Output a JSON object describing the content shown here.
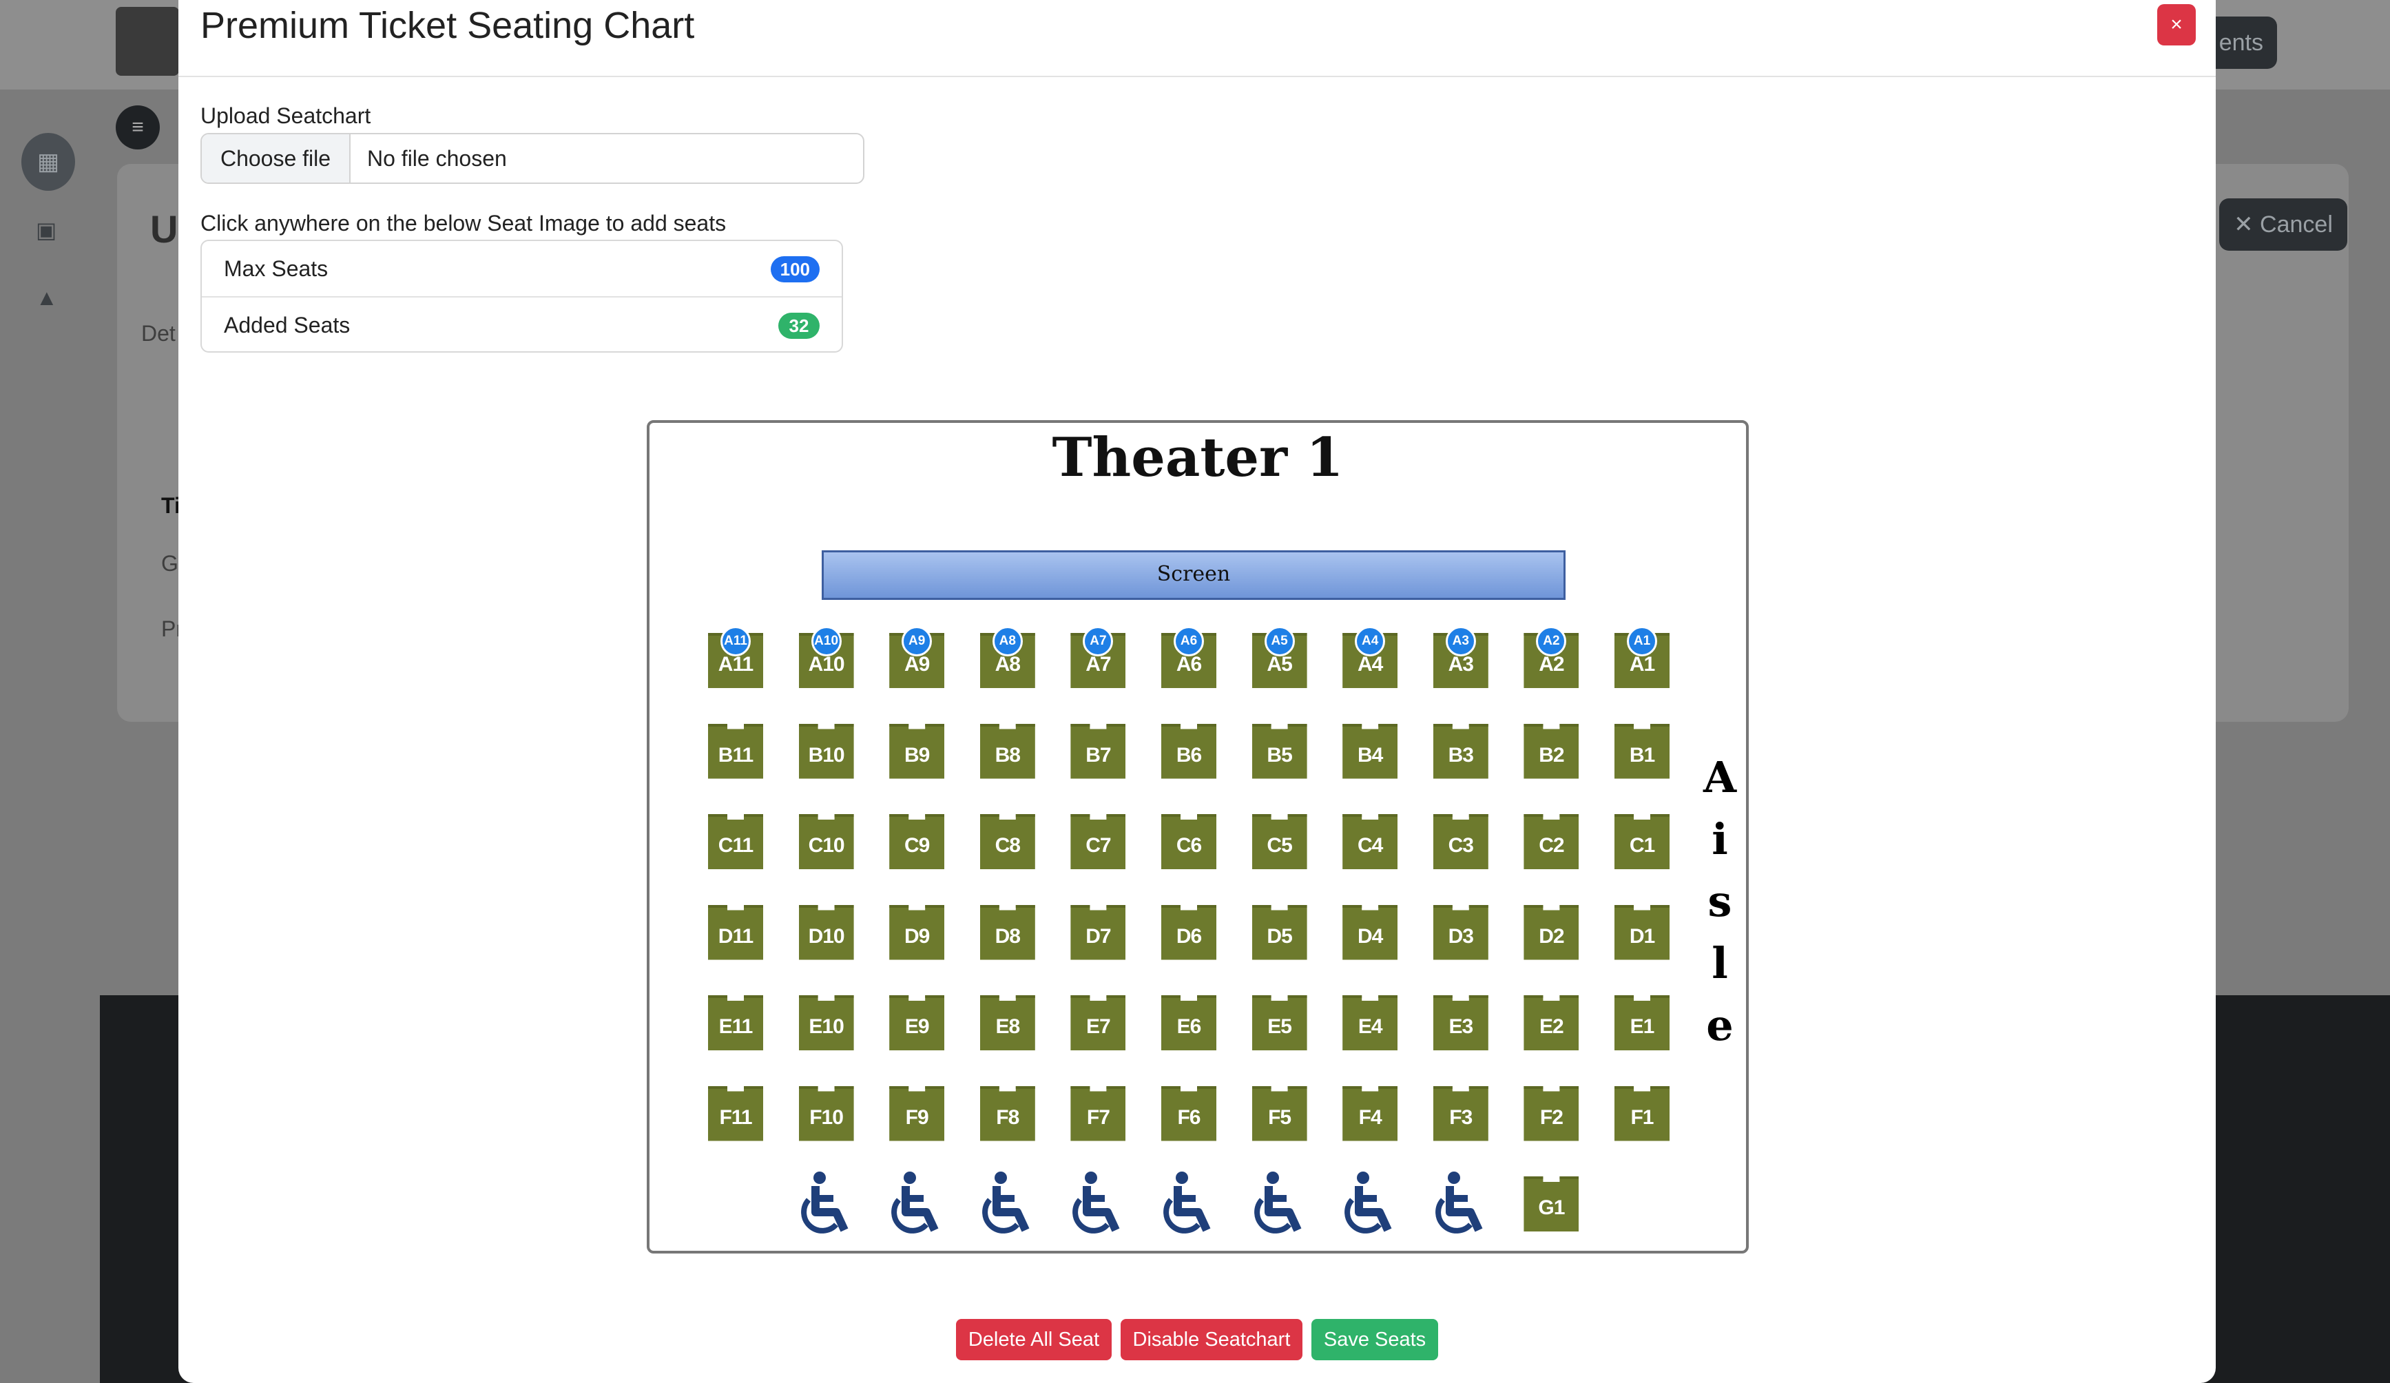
{
  "background": {
    "events_button": "ents",
    "page_heading": "U",
    "cancel_button": "Cancel",
    "tab_label": "Det",
    "table_header": "Ti",
    "row1": "G",
    "row2": "Pr"
  },
  "modal": {
    "title": "Premium Ticket Seating Chart",
    "close_label": "×",
    "upload_label": "Upload Seatchart",
    "choose_file": "Choose file",
    "file_status": "No file chosen",
    "instructions": "Click anywhere on the below Seat Image to add seats",
    "stats": [
      {
        "label": "Max Seats",
        "value": "100",
        "color": "#1e6ff1"
      },
      {
        "label": "Added Seats",
        "value": "32",
        "color": "#2fb36a"
      }
    ],
    "buttons": {
      "delete_all": "Delete All Seat",
      "disable": "Disable Seatchart",
      "save": "Save Seats"
    },
    "button_colors": {
      "delete": "#dc3545",
      "disable": "#dc3545",
      "save": "#2fb36a"
    }
  },
  "seatchart_image": {
    "title": "Theater 1",
    "screen_label": "Screen",
    "aisle_label": "Aisle",
    "rows": [
      {
        "name": "A",
        "seats": [
          "A11",
          "A10",
          "A9",
          "A8",
          "A7",
          "A6",
          "A5",
          "A4",
          "A3",
          "A2",
          "A1"
        ]
      },
      {
        "name": "B",
        "seats": [
          "B11",
          "B10",
          "B9",
          "B8",
          "B7",
          "B6",
          "B5",
          "B4",
          "B3",
          "B2",
          "B1"
        ]
      },
      {
        "name": "C",
        "seats": [
          "C11",
          "C10",
          "C9",
          "C8",
          "C7",
          "C6",
          "C5",
          "C4",
          "C3",
          "C2",
          "C1"
        ]
      },
      {
        "name": "D",
        "seats": [
          "D11",
          "D10",
          "D9",
          "D8",
          "D7",
          "D6",
          "D5",
          "D4",
          "D3",
          "D2",
          "D1"
        ]
      },
      {
        "name": "E",
        "seats": [
          "E11",
          "E10",
          "E9",
          "E8",
          "E7",
          "E6",
          "E5",
          "E4",
          "E3",
          "E2",
          "E1"
        ]
      },
      {
        "name": "F",
        "seats": [
          "F11",
          "F10",
          "F9",
          "F8",
          "F7",
          "F6",
          "F5",
          "F4",
          "F3",
          "F2",
          "F1"
        ]
      }
    ],
    "accessible_seat_count": 8,
    "last_row_seat": "G1",
    "seat_color": "#6d7a2d",
    "wheelchair_color": "#1f3f7a"
  },
  "added_seat_markers": [
    "A1",
    "A2",
    "A3",
    "A4",
    "A5",
    "A6",
    "A7",
    "A8",
    "A9",
    "A10",
    "A11"
  ],
  "marker_color": "#1e7fe6"
}
